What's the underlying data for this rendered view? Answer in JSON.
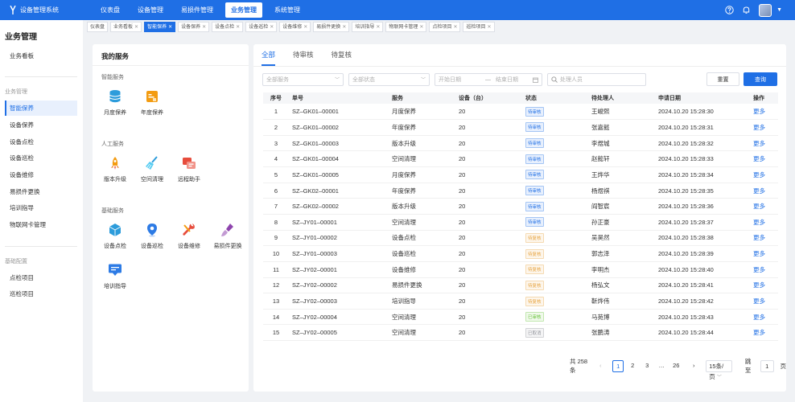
{
  "app": {
    "title": "设备管理系统"
  },
  "topnav": [
    {
      "label": "仪表盘"
    },
    {
      "label": "设备管理"
    },
    {
      "label": "易损件管理"
    },
    {
      "label": "业务管理",
      "active": true
    },
    {
      "label": "系统管理"
    }
  ],
  "sidebar": {
    "title": "业务管理",
    "top_item": "业务看板",
    "group1": "业务管理",
    "items": [
      "智能保养",
      "设备保养",
      "设备点检",
      "设备巡检",
      "设备维修",
      "易损件更换",
      "培训指导",
      "物联网卡管理"
    ],
    "active_index": 0,
    "group2": "基础配置",
    "config_items": [
      "点检项目",
      "巡检项目"
    ]
  },
  "tabs": [
    "仪表盘",
    "业务看板",
    "智能保养",
    "设备保养",
    "设备点检",
    "设备巡检",
    "设备维修",
    "易损件更换",
    "培训指导",
    "物联网卡管理",
    "点检项目",
    "巡检项目"
  ],
  "tabs_closable_from": 1,
  "tabs_active_index": 2,
  "services": {
    "title": "我的服务",
    "groups": [
      {
        "label": "智能服务",
        "items": [
          {
            "label": "月度保养",
            "icon": "database-icon"
          },
          {
            "label": "年度保养",
            "icon": "calendar-icon"
          }
        ]
      },
      {
        "label": "人工服务",
        "items": [
          {
            "label": "版本升级",
            "icon": "rocket-icon"
          },
          {
            "label": "空间清理",
            "icon": "broom-icon"
          },
          {
            "label": "远程助手",
            "icon": "remote-icon"
          }
        ]
      },
      {
        "label": "基础服务",
        "items": [
          {
            "label": "设备点检",
            "icon": "cube-icon"
          },
          {
            "label": "设备巡检",
            "icon": "location-pin-icon"
          },
          {
            "label": "设备维修",
            "icon": "wrench-icon"
          },
          {
            "label": "易损件更换",
            "icon": "brush-icon"
          },
          {
            "label": "培训指导",
            "icon": "chat-icon"
          }
        ]
      }
    ]
  },
  "main": {
    "subtabs": [
      "全部",
      "待审核",
      "待复核"
    ],
    "filters": {
      "service": "全部服务",
      "status": "全部状态",
      "start": "开始日期",
      "sep": "—",
      "end": "结束日期",
      "person": "处理人员"
    },
    "reset_label": "重置",
    "query_label": "查询",
    "columns": [
      "序号",
      "单号",
      "服务",
      "设备（台）",
      "状态",
      "待处理人",
      "申请日期",
      "操作"
    ],
    "rows": [
      [
        "1",
        "SZ–GK01–00001",
        "月度保养",
        "20",
        "待审核",
        "王峻熙",
        "2024.10.20 15:28:30",
        "更多"
      ],
      [
        "2",
        "SZ–GK01–00002",
        "年度保养",
        "20",
        "待审核",
        "张嘉懿",
        "2024.10.20 15:28:31",
        "更多"
      ],
      [
        "3",
        "SZ–GK01–00003",
        "版本升级",
        "20",
        "待审核",
        "李煜城",
        "2024.10.20 15:28:32",
        "更多"
      ],
      [
        "4",
        "SZ–GK01–00004",
        "空间清理",
        "20",
        "待审核",
        "赵懿轩",
        "2024.10.20 15:28:33",
        "更多"
      ],
      [
        "5",
        "SZ–GK01–00005",
        "月度保养",
        "20",
        "待审核",
        "王烨华",
        "2024.10.20 15:28:34",
        "更多"
      ],
      [
        "6",
        "SZ–GK02–00001",
        "年度保养",
        "20",
        "待审核",
        "杨煜祺",
        "2024.10.20 15:28:35",
        "更多"
      ],
      [
        "7",
        "SZ–GK02–00002",
        "版本升级",
        "20",
        "待审核",
        "阎智宸",
        "2024.10.20 15:28:36",
        "更多"
      ],
      [
        "8",
        "SZ–JY01–00001",
        "空间清理",
        "20",
        "待审核",
        "孙正豪",
        "2024.10.20 15:28:37",
        "更多"
      ],
      [
        "9",
        "SZ–JY01–00002",
        "设备点检",
        "20",
        "待复核",
        "吴昊然",
        "2024.10.20 15:28:38",
        "更多"
      ],
      [
        "10",
        "SZ–JY01–00003",
        "设备巡检",
        "20",
        "待复核",
        "郭志泽",
        "2024.10.20 15:28:39",
        "更多"
      ],
      [
        "11",
        "SZ–JY02–00001",
        "设备维修",
        "20",
        "待复核",
        "李明杰",
        "2024.10.20 15:28:40",
        "更多"
      ],
      [
        "12",
        "SZ–JY02–00002",
        "易损件更换",
        "20",
        "待复核",
        "杨弘文",
        "2024.10.20 15:28:41",
        "更多"
      ],
      [
        "13",
        "SZ–JY02–00003",
        "培训指导",
        "20",
        "待复核",
        "靳烨伟",
        "2024.10.20 15:28:42",
        "更多"
      ],
      [
        "14",
        "SZ–JY02–00004",
        "空间清理",
        "20",
        "已审核",
        "马苑博",
        "2024.10.20 15:28:43",
        "更多"
      ],
      [
        "15",
        "SZ–JY02–00005",
        "空间清理",
        "20",
        "已取消",
        "张鹏涛",
        "2024.10.20 15:28:44",
        "更多"
      ]
    ],
    "status_colors": {
      "待审核": {
        "fg": "#1f6fe5",
        "bg": "#e8f0fd"
      },
      "待复核": {
        "fg": "#e6a23c",
        "bg": "#fdf6ec"
      },
      "已审核": {
        "fg": "#67c23a",
        "bg": "#f0f9eb"
      },
      "已取消": {
        "fg": "#909399",
        "bg": "#f4f4f5"
      }
    },
    "pager": {
      "total": "共 258 条",
      "pages": [
        "1",
        "2",
        "3",
        "…",
        "26"
      ],
      "current": "1",
      "size": "15条/页",
      "goto_label": "跳至",
      "goto_value": "1",
      "page_unit": "页"
    }
  },
  "colors": {
    "accent": "#1f6fe5"
  }
}
